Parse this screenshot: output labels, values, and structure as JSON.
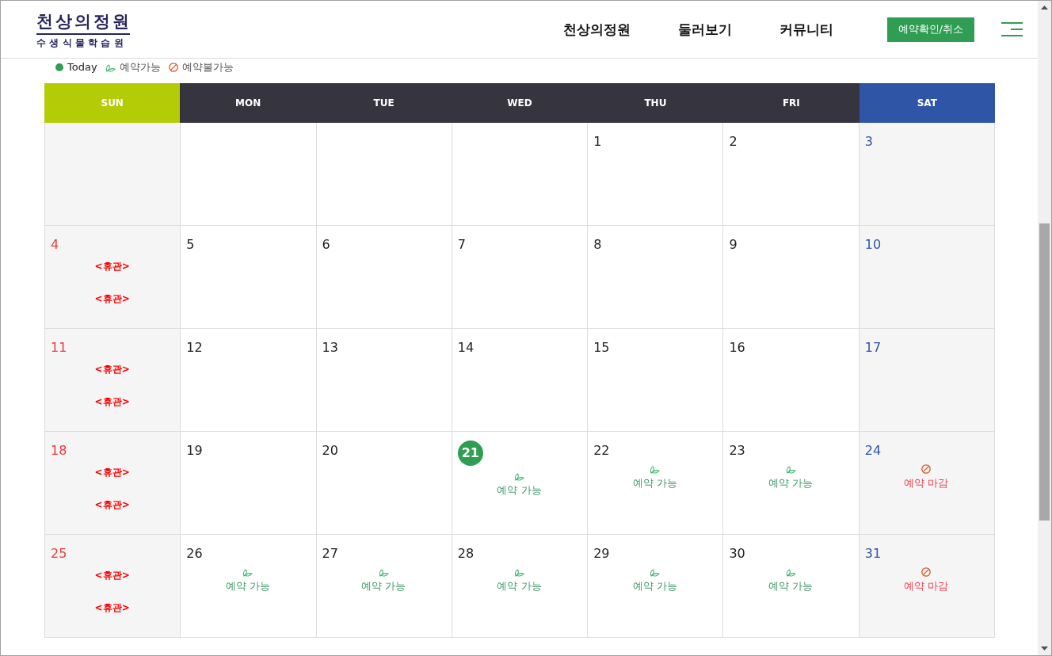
{
  "header": {
    "logo": {
      "title": "천상의정원",
      "subtitle": "수생식물학습원"
    },
    "nav": [
      {
        "label": "천상의정원"
      },
      {
        "label": "둘러보기"
      },
      {
        "label": "커뮤니티"
      }
    ],
    "action_button": "예약확인/취소"
  },
  "legend": [
    {
      "kind": "today",
      "label": "Today"
    },
    {
      "kind": "available",
      "label": "예약가능"
    },
    {
      "kind": "unavailable",
      "label": "예약불가능"
    }
  ],
  "calendar": {
    "weekdays": [
      {
        "label": "SUN",
        "kind": "sunday"
      },
      {
        "label": "MON",
        "kind": "weekday"
      },
      {
        "label": "TUE",
        "kind": "weekday"
      },
      {
        "label": "WED",
        "kind": "weekday"
      },
      {
        "label": "THU",
        "kind": "weekday"
      },
      {
        "label": "FRI",
        "kind": "weekday"
      },
      {
        "label": "SAT",
        "kind": "saturday"
      }
    ],
    "weeks": [
      [
        {
          "kind": "blank"
        },
        {
          "kind": "blank"
        },
        {
          "kind": "blank"
        },
        {
          "kind": "blank"
        },
        {
          "kind": "day",
          "date": "1",
          "today": false
        },
        {
          "kind": "day",
          "date": "2",
          "today": false
        },
        {
          "kind": "day",
          "date": "3",
          "today": false
        }
      ],
      [
        {
          "kind": "day",
          "date": "4",
          "today": false,
          "events": [
            {
              "kind": "closed",
              "label": "<휴관>"
            },
            {
              "kind": "closed",
              "label": "<휴관>"
            }
          ]
        },
        {
          "kind": "day",
          "date": "5",
          "today": false
        },
        {
          "kind": "day",
          "date": "6",
          "today": false
        },
        {
          "kind": "day",
          "date": "7",
          "today": false
        },
        {
          "kind": "day",
          "date": "8",
          "today": false
        },
        {
          "kind": "day",
          "date": "9",
          "today": false
        },
        {
          "kind": "day",
          "date": "10",
          "today": false
        }
      ],
      [
        {
          "kind": "day",
          "date": "11",
          "today": false,
          "events": [
            {
              "kind": "closed",
              "label": "<휴관>"
            },
            {
              "kind": "closed",
              "label": "<휴관>"
            }
          ]
        },
        {
          "kind": "day",
          "date": "12",
          "today": false
        },
        {
          "kind": "day",
          "date": "13",
          "today": false
        },
        {
          "kind": "day",
          "date": "14",
          "today": false
        },
        {
          "kind": "day",
          "date": "15",
          "today": false
        },
        {
          "kind": "day",
          "date": "16",
          "today": false
        },
        {
          "kind": "day",
          "date": "17",
          "today": false
        }
      ],
      [
        {
          "kind": "day",
          "date": "18",
          "today": false,
          "events": [
            {
              "kind": "closed",
              "label": "<휴관>"
            },
            {
              "kind": "closed",
              "label": "<휴관>"
            }
          ]
        },
        {
          "kind": "day",
          "date": "19",
          "today": false
        },
        {
          "kind": "day",
          "date": "20",
          "today": false
        },
        {
          "kind": "day",
          "date": "21",
          "today": true,
          "events": [
            {
              "kind": "available",
              "label": "예약 가능"
            }
          ]
        },
        {
          "kind": "day",
          "date": "22",
          "today": false,
          "events": [
            {
              "kind": "available",
              "label": "예약 가능"
            }
          ]
        },
        {
          "kind": "day",
          "date": "23",
          "today": false,
          "events": [
            {
              "kind": "available",
              "label": "예약 가능"
            }
          ]
        },
        {
          "kind": "day",
          "date": "24",
          "today": false,
          "events": [
            {
              "kind": "full",
              "label": "예약 마감"
            }
          ]
        }
      ],
      [
        {
          "kind": "day",
          "date": "25",
          "today": false,
          "events": [
            {
              "kind": "closed",
              "label": "<휴관>"
            },
            {
              "kind": "closed",
              "label": "<휴관>"
            }
          ]
        },
        {
          "kind": "day",
          "date": "26",
          "today": false,
          "events": [
            {
              "kind": "available",
              "label": "예약 가능"
            }
          ]
        },
        {
          "kind": "day",
          "date": "27",
          "today": false,
          "events": [
            {
              "kind": "available",
              "label": "예약 가능"
            }
          ]
        },
        {
          "kind": "day",
          "date": "28",
          "today": false,
          "events": [
            {
              "kind": "available",
              "label": "예약 가능"
            }
          ]
        },
        {
          "kind": "day",
          "date": "29",
          "today": false,
          "events": [
            {
              "kind": "available",
              "label": "예약 가능"
            }
          ]
        },
        {
          "kind": "day",
          "date": "30",
          "today": false,
          "events": [
            {
              "kind": "available",
              "label": "예약 가능"
            }
          ]
        },
        {
          "kind": "day",
          "date": "31",
          "today": false,
          "events": [
            {
              "kind": "full",
              "label": "예약 마감"
            }
          ]
        }
      ]
    ]
  }
}
